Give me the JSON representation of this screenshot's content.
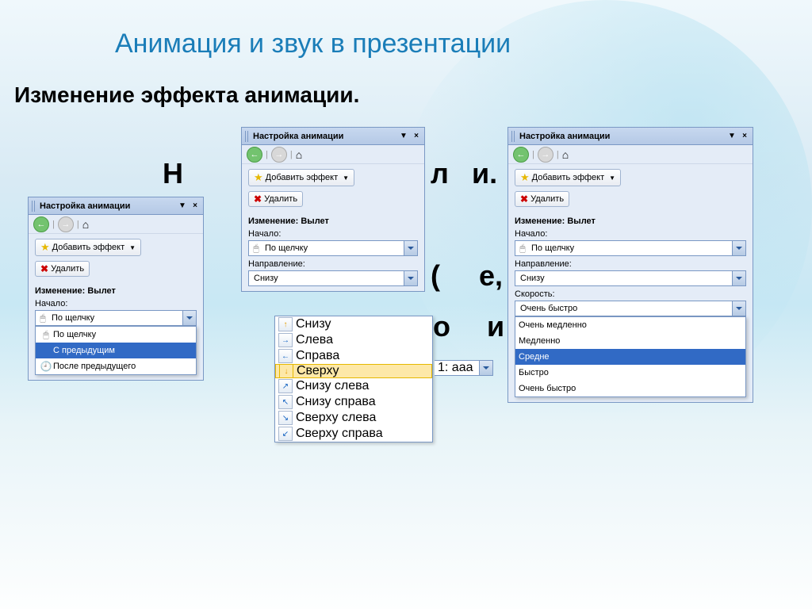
{
  "title": "Анимация и звук в презентации",
  "subtitle": "Изменение эффекта анимации.",
  "panel_header": "Настройка анимации",
  "buttons": {
    "add_effect": "Добавить эффект",
    "delete": "Удалить"
  },
  "labels": {
    "change": "Изменение: Вылет",
    "start": "Начало:",
    "direction": "Направление:",
    "speed": "Скорость:"
  },
  "start_value": "По щелчку",
  "start_options": [
    {
      "icon": "mouse",
      "text": "По щелчку"
    },
    {
      "icon": "blank",
      "text": "С предыдущим"
    },
    {
      "icon": "clock",
      "text": "После предыдущего"
    }
  ],
  "start_selected_index": 1,
  "direction_value": "Снизу",
  "direction_options": [
    {
      "arrow": "up",
      "text": "Снизу"
    },
    {
      "arrow": "right",
      "text": "Слева"
    },
    {
      "arrow": "left",
      "text": "Справа"
    },
    {
      "arrow": "down",
      "text": "Сверху"
    },
    {
      "arrow": "ne",
      "text": "Снизу слева"
    },
    {
      "arrow": "nw",
      "text": "Снизу справа"
    },
    {
      "arrow": "se",
      "text": "Сверху слева"
    },
    {
      "arrow": "sw",
      "text": "Сверху справа"
    }
  ],
  "direction_hover_index": 3,
  "speed_value": "Очень быстро",
  "speed_options": [
    "Очень медленно",
    "Медленно",
    "Средне",
    "Быстро",
    "Очень быстро"
  ],
  "speed_selected_index": 2,
  "item_marker": "1: aaa",
  "bg_frag": {
    "a": "Н",
    "b": "л",
    "c": "и.",
    "d": "(",
    "e": "е,",
    "f": "о",
    "g": "и"
  }
}
